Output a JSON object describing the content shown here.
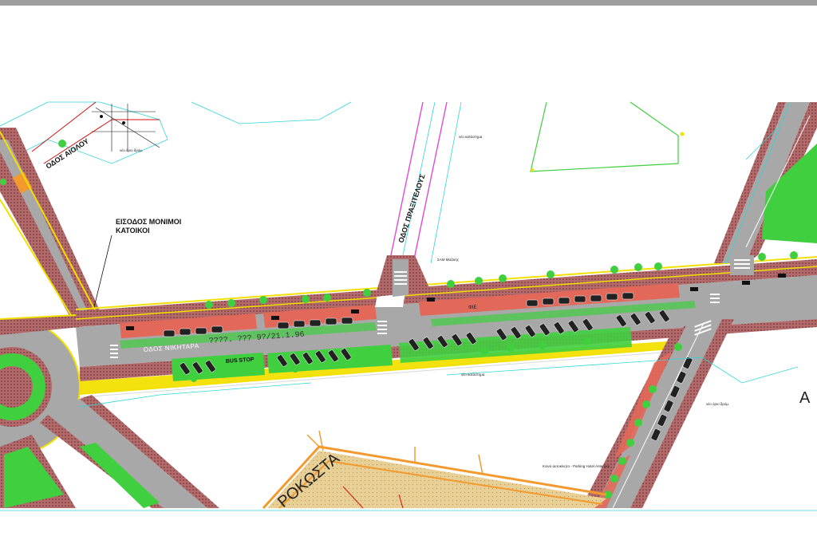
{
  "map": {
    "labels": {
      "entrance_note_line1": "ΕΙΣΟΔΟΣ ΜΟΝΙΜΟΙ",
      "entrance_note_line2": "ΚΑΤΟΙΚΟΙ",
      "street_nikitara": "ΟΔΟΣ ΝΙΚΗΤΑΡΑ",
      "street_praxitelous": "ΟΔΟΣ ΠΡΑΞΙΤΕΛΟΥΣ",
      "street_upper_left": "ΟΔΟΣ ΑΙΟΛΟΥ",
      "street_bottom": "ΡΟΚΩΣΤΑ",
      "ref_code": "????. ??? 9?/21.1.96",
      "bus_stop": "BUS STOP",
      "parking_note": "Κοινό αυτοκίνητο - Parking Hotel Antenore",
      "letter_right": "A",
      "small_notes": [
        "νέο όριο δρόμ.",
        "νέο κατάστημα",
        "ΣΑΜ Μαζικής",
        "νέο κατάστημα",
        "νέο όριο δρόμ."
      ],
      "small_mark": "ΦΙΕ"
    },
    "colors": {
      "road": "#a8a8a8",
      "sidewalk": "#a35858",
      "green": "#3fcf3f",
      "median": "#e2695a",
      "yellow_line": "#f2e000",
      "magenta": "#e04ad8",
      "cyan": "#2fd6d6",
      "orange_path": "#f39a2e",
      "tan_fill": "#e8cf95",
      "dark_red": "#d01010"
    }
  }
}
